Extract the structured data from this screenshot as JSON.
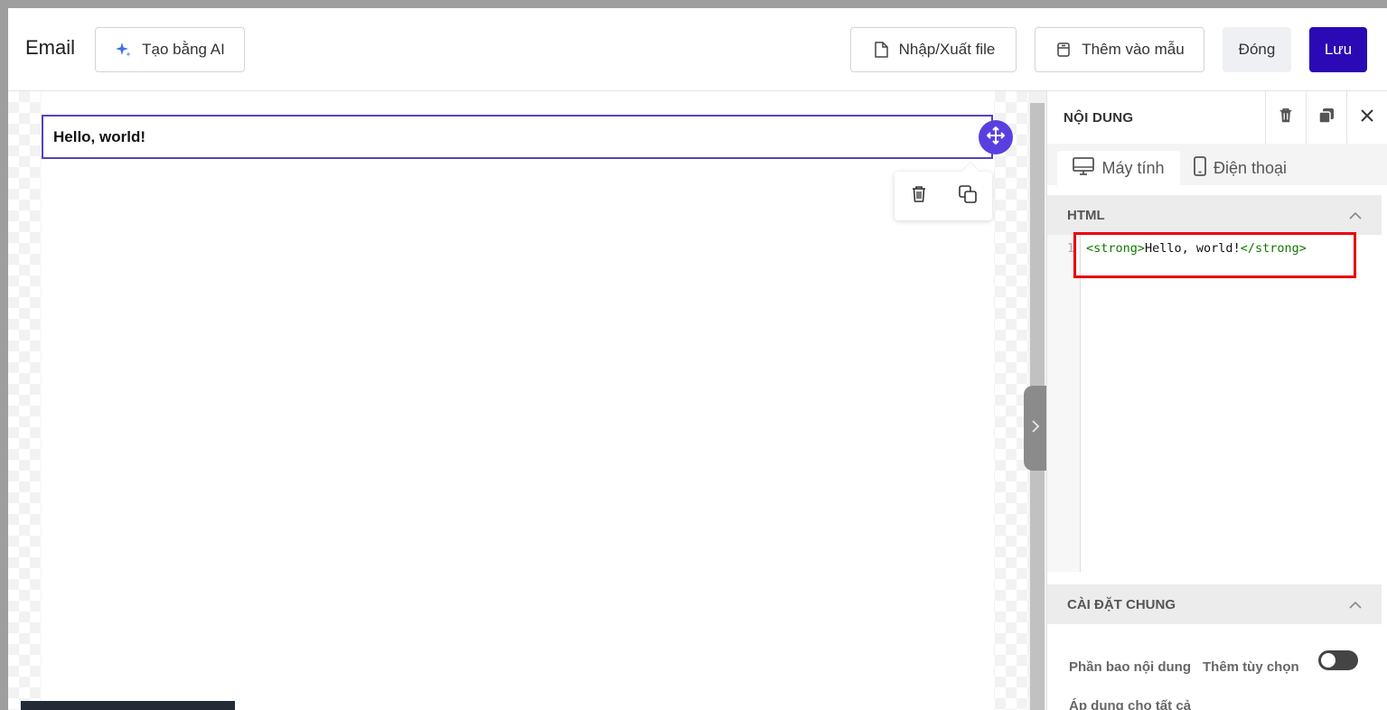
{
  "header": {
    "title": "Email",
    "ai_button_label": "Tạo bằng AI",
    "import_export_label": "Nhập/Xuất file",
    "add_template_label": "Thêm vào mẫu",
    "close_label": "Đóng",
    "save_label": "Lưu"
  },
  "canvas": {
    "text_block_content": "Hello, world!"
  },
  "panel": {
    "title": "NỘI DUNG",
    "tabs": [
      {
        "label": "Máy tính",
        "active": true,
        "icon": "desktop-icon"
      },
      {
        "label": "Điện thoại",
        "active": false,
        "icon": "mobile-icon"
      }
    ],
    "html_section": {
      "title": "HTML",
      "line_number": "1",
      "code": {
        "open_tag": "<strong>",
        "text": "Hello, world!",
        "close_tag": "</strong>"
      }
    },
    "general_section": {
      "title": "CÀI ĐẶT CHUNG",
      "content_wrapper_label": "Phần bao nội dung",
      "add_option_label": "Thêm tùy chọn",
      "apply_all_label": "Áp dụng cho tất cả"
    }
  },
  "colors": {
    "primary": "#2b09b5",
    "accent": "#5a3fe0",
    "highlight": "#e8000d",
    "code_tag": "#117700"
  }
}
